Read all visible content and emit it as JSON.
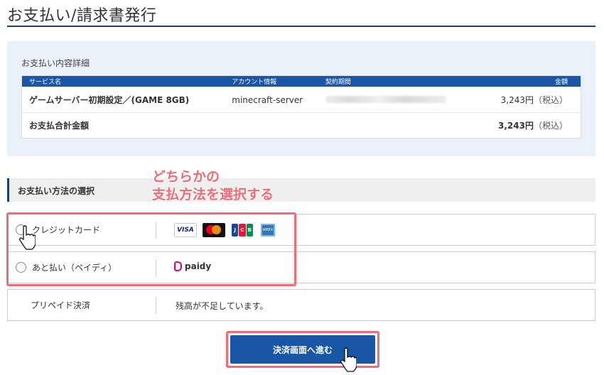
{
  "page": {
    "title": "お支払い/請求書発行"
  },
  "details": {
    "heading": "お支払い内容詳細",
    "columns": [
      "サービス名",
      "アカウント情報",
      "契約期間",
      "金額"
    ],
    "item": {
      "service": "ゲームサーバー初期設定／(GAME 8GB)",
      "account": "minecraft-server",
      "amount": "3,243円",
      "tax": "（税込）"
    },
    "total": {
      "label": "お支払合計金額",
      "amount": "3,243円",
      "tax": "（税込）"
    }
  },
  "payment_methods": {
    "heading": "お支払い方法の選択",
    "annotation_line1": "どちらかの",
    "annotation_line2": "支払方法を選択する",
    "options": [
      {
        "label": "クレジットカード",
        "icons": [
          "visa-icon",
          "mastercard-icon",
          "jcb-icon",
          "amex-icon"
        ]
      },
      {
        "label": "あと払い（ペイディ）",
        "icons": [
          "paidy-icon"
        ],
        "logo_text": "paidy"
      },
      {
        "label": "プリペイド決済",
        "note": "残高が不足しています。"
      }
    ],
    "card_logos": {
      "visa": "VISA",
      "jcb_j": "J",
      "jcb_c": "C",
      "jcb_b": "B",
      "amex": "AMEX"
    }
  },
  "submit": {
    "label": "決済画面へ進む"
  },
  "colors": {
    "brand_blue": "#1a56a6",
    "title_rule": "#1b3f7c",
    "annotation_pink": "#f26a78",
    "panel_bg": "#eaf1f9"
  }
}
